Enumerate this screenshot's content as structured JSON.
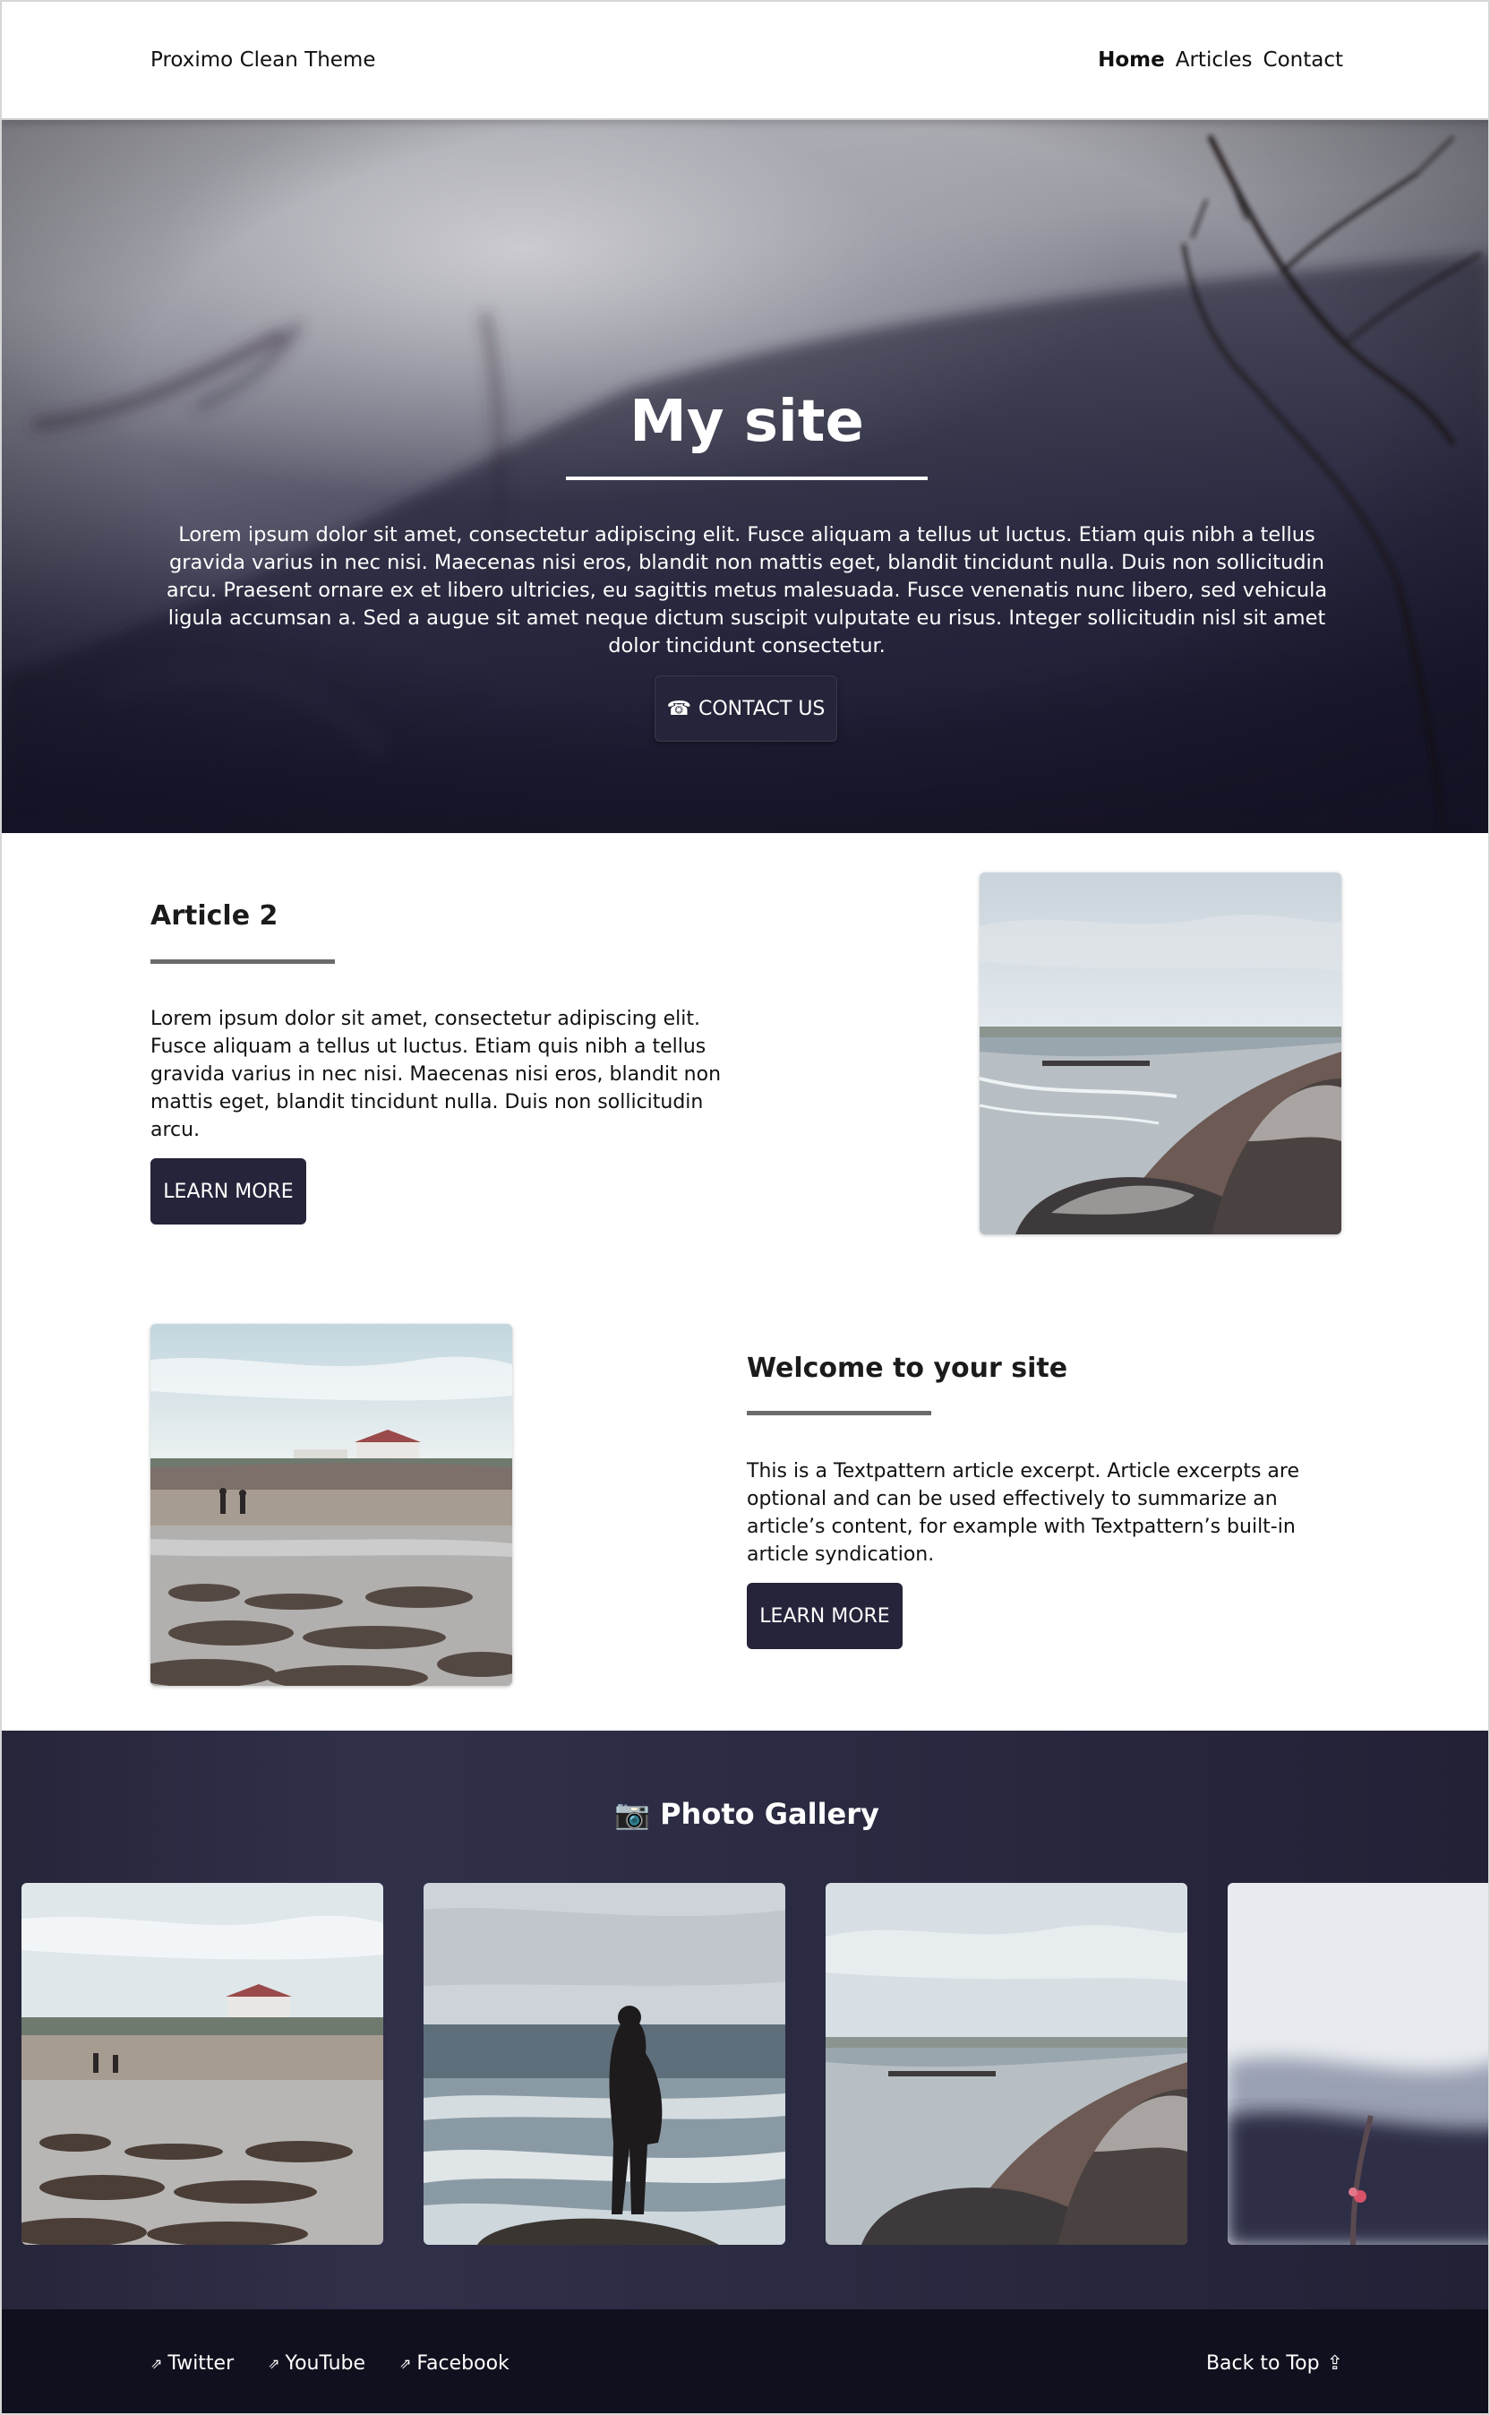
{
  "header": {
    "brand": "Proximo Clean Theme",
    "nav": [
      {
        "label": "Home",
        "active": true
      },
      {
        "label": "Articles",
        "active": false
      },
      {
        "label": "Contact",
        "active": false
      }
    ]
  },
  "hero": {
    "title": "My site",
    "text": "Lorem ipsum dolor sit amet, consectetur adipiscing elit. Fusce aliquam a tellus ut luctus. Etiam quis nibh a tellus gravida varius in nec nisi. Maecenas nisi eros, blandit non mattis eget, blandit tincidunt nulla. Duis non sollicitudin arcu. Praesent ornare ex et libero ultricies, eu sagittis metus malesuada. Fusce venenatis nunc libero, sed vehicula ligula accumsan a. Sed a augue sit amet neque dictum suscipit vulputate eu risus. Integer sollicitudin nisl sit amet dolor tincidunt consectetur.",
    "button_icon": "☎",
    "button_label": "CONTACT US"
  },
  "articles": [
    {
      "title": "Article 2",
      "text": "Lorem ipsum dolor sit amet, consectetur adipiscing elit. Fusce aliquam a tellus ut luctus. Etiam quis nibh a tellus gravida varius in nec nisi. Maecenas nisi eros, blandit non mattis eget, blandit tincidunt nulla. Duis non sollicitudin arcu.",
      "button_label": "LEARN MORE",
      "image_icon": "beach-rocks-photo"
    },
    {
      "title": "Welcome to your site",
      "text": "This is a Textpattern article excerpt. Article excerpts are optional and can be used effectively to summarize an article’s content, for example with Textpattern’s built-in article syndication.",
      "button_label": "LEARN MORE",
      "image_icon": "beach-walkers-photo"
    }
  ],
  "gallery": {
    "icon": "📷",
    "title": "Photo Gallery"
  },
  "footer": {
    "social": [
      {
        "icon": "⇗",
        "label": "Twitter"
      },
      {
        "icon": "⇗",
        "label": "YouTube"
      },
      {
        "icon": "⇗",
        "label": "Facebook"
      }
    ],
    "back_to_top": "Back to Top",
    "back_to_top_icon": "⇪"
  },
  "colors": {
    "accent_dark": "#25243a",
    "gallery_bg": "#2a2a42",
    "footer_bg": "#11101e"
  }
}
